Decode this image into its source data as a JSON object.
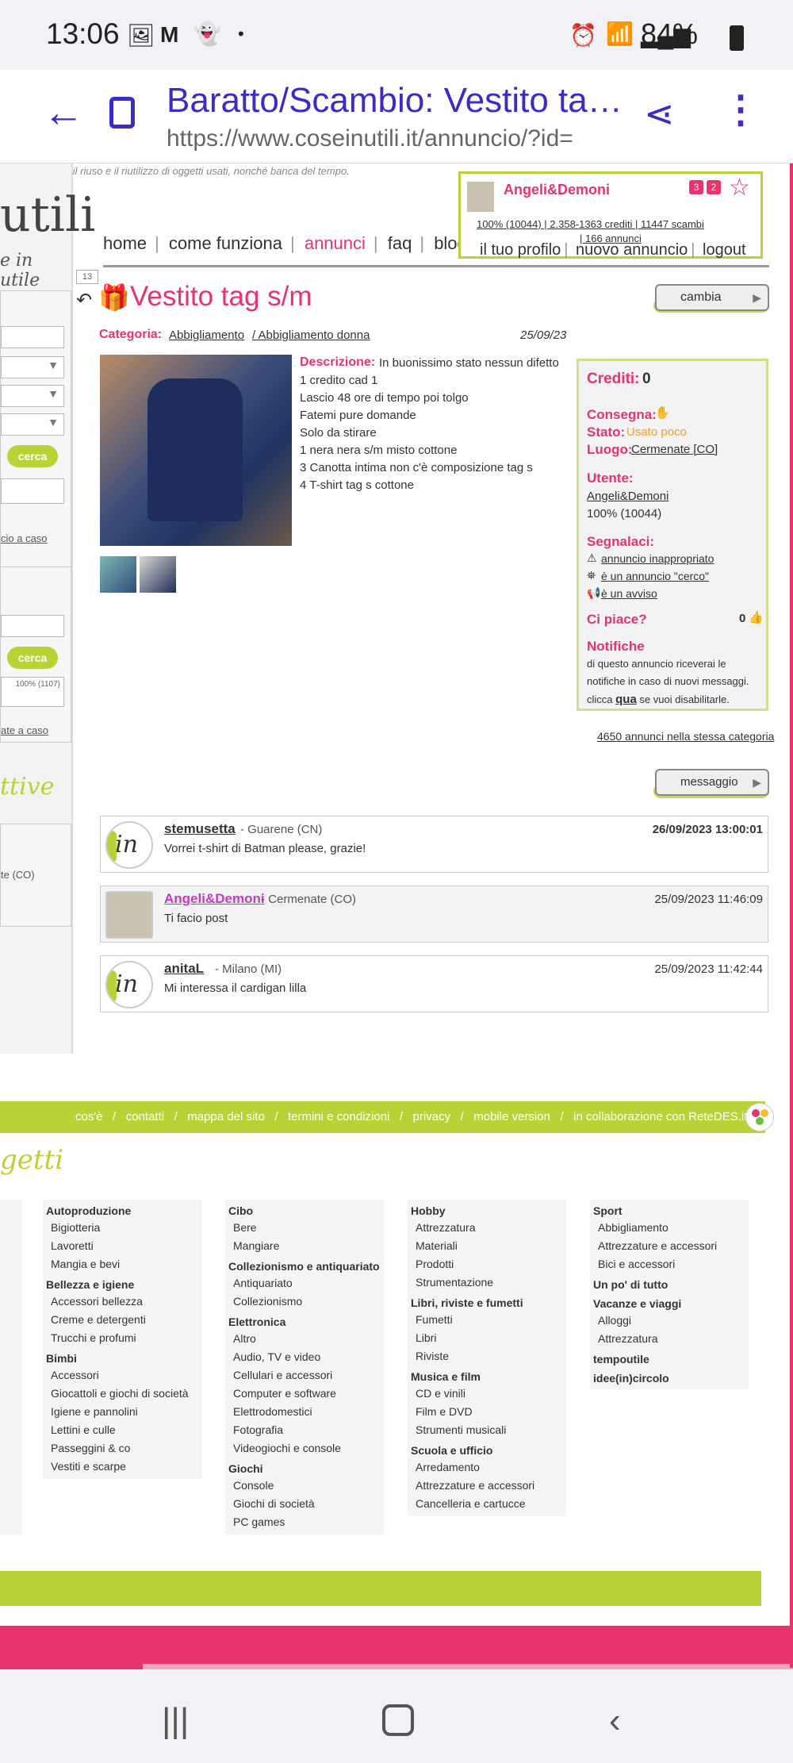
{
  "status_bar": {
    "time": "13:06",
    "battery": "84%"
  },
  "browser": {
    "page_title": "Baratto/Scambio: Vestito ta…",
    "url": "https://www.coseinutili.it/annuncio/?id="
  },
  "site": {
    "tagline": "per lo scambio, il riuso e il riutilizzo di oggetti usati, nonché banca del tempo.",
    "logo_text": "utili",
    "logo_sub": "e in utile",
    "nav": [
      "home",
      "come funziona",
      "annunci",
      "faq",
      "blog"
    ],
    "user": {
      "name": "Angeli&Demoni",
      "badges": [
        "3",
        "2"
      ],
      "stats": "100% (10044) | 2.358-1363 crediti | 11447 scambi",
      "annunci": "| 166 annunci",
      "links": [
        "il tuo profilo",
        "nuovo annuncio",
        "logout"
      ]
    },
    "left": {
      "cerca1": "cerca",
      "caso1": "cio a caso",
      "cerca2": "cerca",
      "rating": "100% (1107)",
      "caso2": "ate a caso",
      "tive": "ttive",
      "loc": "te (CO)"
    }
  },
  "ad": {
    "counter": "13",
    "title": "Vestito tag s/m",
    "cambia": "cambia",
    "category_label": "Categoria:",
    "category": "Abbigliamento",
    "subcategory": "/ Abbigliamento donna",
    "date": "25/09/23",
    "description_label": "Descrizione:",
    "description_first": "In buonissimo stato nessun difetto",
    "description_lines": [
      "1 credito cad 1",
      "Lascio 48 ore di tempo poi tolgo",
      "Fatemi pure domande",
      "Solo da stirare",
      "1 nera nera s/m misto cottone",
      "3 Canotta intima non c'è composizione tag s",
      "4 T-shirt tag s cottone"
    ]
  },
  "sidebox": {
    "crediti_label": "Crediti:",
    "crediti": "0",
    "consegna_label": "Consegna:",
    "stato_label": "Stato:",
    "stato": "Usato poco",
    "luogo_label": "Luogo:",
    "luogo": "Cermenate [CO]",
    "utente_label": "Utente:",
    "utente": "Angeli&Demoni",
    "utente_rating": "100% (10044)",
    "segnalaci_label": "Segnalaci:",
    "segnalaci": [
      " annuncio inappropriato",
      " è un annuncio \"cerco\"",
      " è un avviso"
    ],
    "ci_piace_label": "Ci piace?",
    "ci_piace": "0",
    "notifiche_label": "Notifiche",
    "notifiche_1": "di questo annuncio riceverai le",
    "notifiche_2": "notifiche in caso di nuovi messaggi.",
    "notifiche_3a": "clicca ",
    "notifiche_qua": "qua",
    "notifiche_3b": " se vuoi disabilitarle."
  },
  "same_category": "4650 annunci nella stessa categoria",
  "messaggio": "messaggio",
  "messages": [
    {
      "name": "stemusetta",
      "loc": "- Guarene (CN)",
      "date": "26/09/2023 13:00:01",
      "text": "Vorrei t-shirt di Batman please, grazie!"
    },
    {
      "name": "Angeli&Demoni",
      "loc": "- Cermenate (CO)",
      "date": "25/09/2023 11:46:09",
      "text": "Ti facio post"
    },
    {
      "name": "anitaL",
      "loc": "- Milano (MI)",
      "date": "25/09/2023 11:42:44",
      "text": "Mi interessa il cardigan lilla"
    }
  ],
  "footer": {
    "links": "cos'è   /   contatti   /   mappa del sito   /   termini e condizioni   /   privacy   /   mobile version   /   in collaborazione con ReteDES.it",
    "oggetti": "getti"
  },
  "categories": [
    {
      "groups": [
        {
          "h": "Autoproduzione",
          "items": [
            "Bigiotteria",
            "Lavoretti",
            "Mangia e bevi"
          ]
        },
        {
          "h": "Bellezza e igiene",
          "items": [
            "Accessori bellezza",
            "Creme e detergenti",
            "Trucchi e profumi"
          ]
        },
        {
          "h": "Bimbi",
          "items": [
            "Accessori",
            "Giocattoli e giochi di società",
            "Igiene e pannolini",
            "Lettini e culle",
            "Passeggini & co",
            "Vestiti e scarpe"
          ]
        }
      ]
    },
    {
      "groups": [
        {
          "h": "Cibo",
          "items": [
            "Bere",
            "Mangiare"
          ]
        },
        {
          "h": "Collezionismo e antiquariato",
          "items": [
            "Antiquariato",
            "Collezionismo"
          ]
        },
        {
          "h": "Elettronica",
          "items": [
            "Altro",
            "Audio, TV e video",
            "Cellulari e accessori",
            "Computer e software",
            "Elettrodomestici",
            "Fotografia",
            "Videogiochi e console"
          ]
        },
        {
          "h": "Giochi",
          "items": [
            "Console",
            "Giochi di società",
            "PC games"
          ]
        }
      ]
    },
    {
      "groups": [
        {
          "h": "Hobby",
          "items": [
            "Attrezzatura",
            "Materiali",
            "Prodotti",
            "Strumentazione"
          ]
        },
        {
          "h": "Libri, riviste e fumetti",
          "items": [
            "Fumetti",
            "Libri",
            "Riviste"
          ]
        },
        {
          "h": "Musica e film",
          "items": [
            "CD e vinili",
            "Film e DVD",
            "Strumenti musicali"
          ]
        },
        {
          "h": "Scuola e ufficio",
          "items": [
            "Arredamento",
            "Attrezzature e accessori",
            "Cancelleria e cartucce"
          ]
        }
      ]
    },
    {
      "groups": [
        {
          "h": "Sport",
          "items": [
            "Abbigliamento",
            "Attrezzature e accessori",
            "Bici e accessori"
          ]
        },
        {
          "h": "Un po' di tutto",
          "items": []
        },
        {
          "h": "Vacanze e viaggi",
          "items": [
            "Alloggi",
            "Attrezzatura"
          ]
        },
        {
          "h": "tempoutile",
          "items": []
        },
        {
          "h": "idee(in)circolo",
          "items": []
        }
      ]
    }
  ]
}
